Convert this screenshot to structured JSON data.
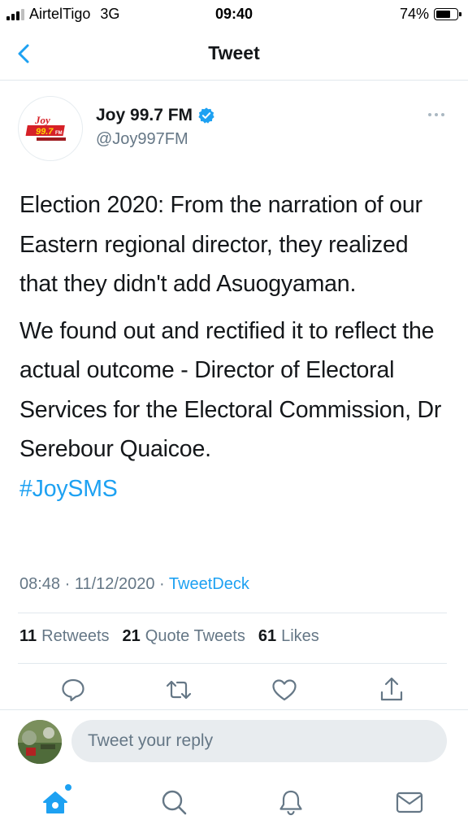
{
  "status_bar": {
    "carrier": "AirtelTigo",
    "network": "3G",
    "time": "09:40",
    "battery_text": "74%",
    "battery_level": 0.74
  },
  "nav": {
    "back_icon": "chevron-left-icon",
    "title": "Tweet"
  },
  "tweet": {
    "display_name": "Joy 99.7 FM",
    "verified": true,
    "handle": "@Joy997FM",
    "paragraph1": "Election 2020: From the narration of our Eastern regional director, they realized that they didn't add Asuogyaman.",
    "paragraph2": "We found out and rectified it to reflect the actual outcome -  Director of Electoral Services for the Electoral Commission, Dr Serebour Quaicoe.",
    "hashtag": "#JoySMS",
    "time": "08:48",
    "separator": "·",
    "date": "11/12/2020",
    "source": "TweetDeck"
  },
  "stats": {
    "retweets_count": "11",
    "retweets_label": "Retweets",
    "quotes_count": "21",
    "quotes_label": "Quote Tweets",
    "likes_count": "61",
    "likes_label": "Likes"
  },
  "actions": {
    "reply_icon": "comment-icon",
    "retweet_icon": "retweet-icon",
    "like_icon": "heart-icon",
    "share_icon": "share-icon"
  },
  "reply": {
    "placeholder": "Tweet your reply"
  },
  "tabs": [
    "home-icon",
    "search-icon",
    "notifications-bell-icon",
    "messages-envelope-icon"
  ],
  "colors": {
    "accent": "#1da1f2",
    "text": "#14171a",
    "secondary": "#657786"
  }
}
